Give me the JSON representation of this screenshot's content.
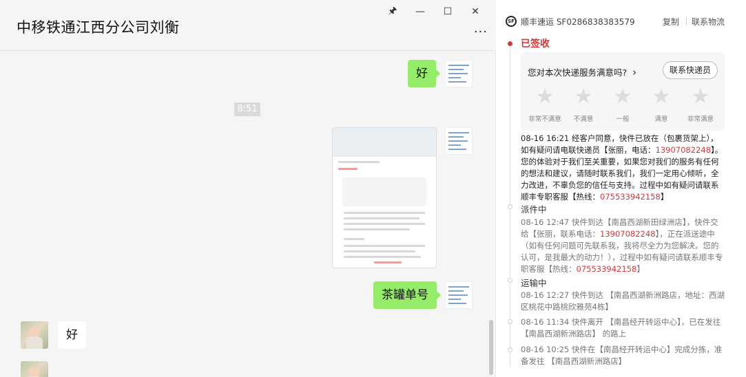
{
  "chat": {
    "title": "中移铁通江西分公司刘衡",
    "window_controls": {
      "pin": "🖈",
      "minimize": "—",
      "maximize": "☐",
      "close": "✕"
    },
    "more": "···",
    "messages": [
      {
        "side": "right",
        "type": "text",
        "text": "好"
      },
      {
        "type": "time",
        "text": "8:51"
      },
      {
        "side": "right",
        "type": "image",
        "text": ""
      },
      {
        "side": "right",
        "type": "text",
        "text": "茶罐单号"
      },
      {
        "side": "left",
        "type": "text",
        "text": "好"
      }
    ]
  },
  "tracking": {
    "carrier": "顺丰速运 SF0286838383579",
    "logo": "SF",
    "copy": "复制",
    "contact": "联系物流",
    "status": "已签收",
    "rating": {
      "question": "您对本次快递服务满意吗?",
      "arrow": "›",
      "button": "联系快递员",
      "star": "★",
      "labels": [
        "非常不满意",
        "不满意",
        "一般",
        "满意",
        "非常满意"
      ]
    },
    "events": {
      "signed_p1": "08-16 16:21  经客户同意，快件已放在（包裹货架上），如有疑问请电联快递员【张丽，电话：",
      "signed_phone": "13907082248",
      "signed_p2": "】。您的体验对于我们至关重要，如果您对我们的服务有任何的想法和建议，请随时联系我们，我们一定用心倾听，全力改进，不辜负您的信任与支持。过程中如有疑问请联系顺丰专职客服【热线：",
      "hotline": "075533942158",
      "close_bracket": "】",
      "dispatch_head": "派件中",
      "dispatch_p1": "08-16 12:47  快件到达【南昌西湖新田绿洲店】，快件交给【张丽，联系电话：",
      "dispatch_phone": "13907082248",
      "dispatch_p2": "】，正在派送途中（如有任何问题可先联系我，我将尽全力为您解决。您的认可，是我最大的动力！），过程中如有疑问请联系顺丰专职客服【热线：",
      "dispatch_hotline": "075533942158",
      "transit_head": "运输中",
      "transit_1": "08-16 12:27  快件到达 【南昌西湖新洲路店，地址：西湖区桃花中路桃欣雅苑4栋】",
      "transit_2": "08-16 11:34  快件离开 【南昌经开转运中心】，已在发往【南昌西湖新洲路店】 的路上",
      "transit_3": "08-16 10:25  快件在【南昌经开转运中心】完成分拣，准备发往 【南昌西湖新洲路店】"
    }
  }
}
